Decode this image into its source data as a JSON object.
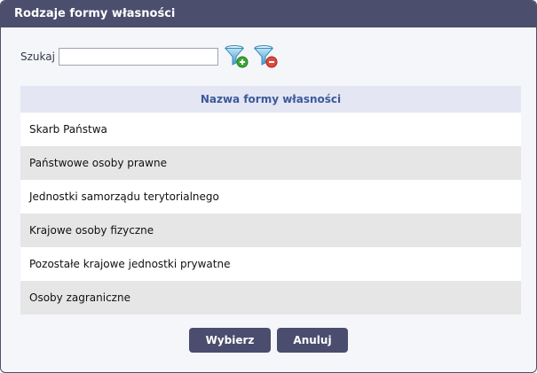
{
  "dialog": {
    "title": "Rodzaje formy własności"
  },
  "search": {
    "label": "Szukaj",
    "value": "",
    "placeholder": ""
  },
  "icons": {
    "apply_filter": "filter-add-icon",
    "clear_filter": "filter-remove-icon"
  },
  "colors": {
    "titlebar": "#4b4e6d",
    "header_text": "#3b5a9a",
    "button": "#4a4d6d",
    "filter_add_badge": "#3aa832",
    "filter_remove_badge": "#e04a3a"
  },
  "table": {
    "header": "Nazwa formy własności",
    "rows": [
      "Skarb Państwa",
      "Państwowe osoby prawne",
      "Jednostki samorządu terytorialnego",
      "Krajowe osoby fizyczne",
      "Pozostałe krajowe jednostki prywatne",
      "Osoby zagraniczne"
    ]
  },
  "buttons": {
    "select_label": "Wybierz",
    "cancel_label": "Anuluj"
  }
}
